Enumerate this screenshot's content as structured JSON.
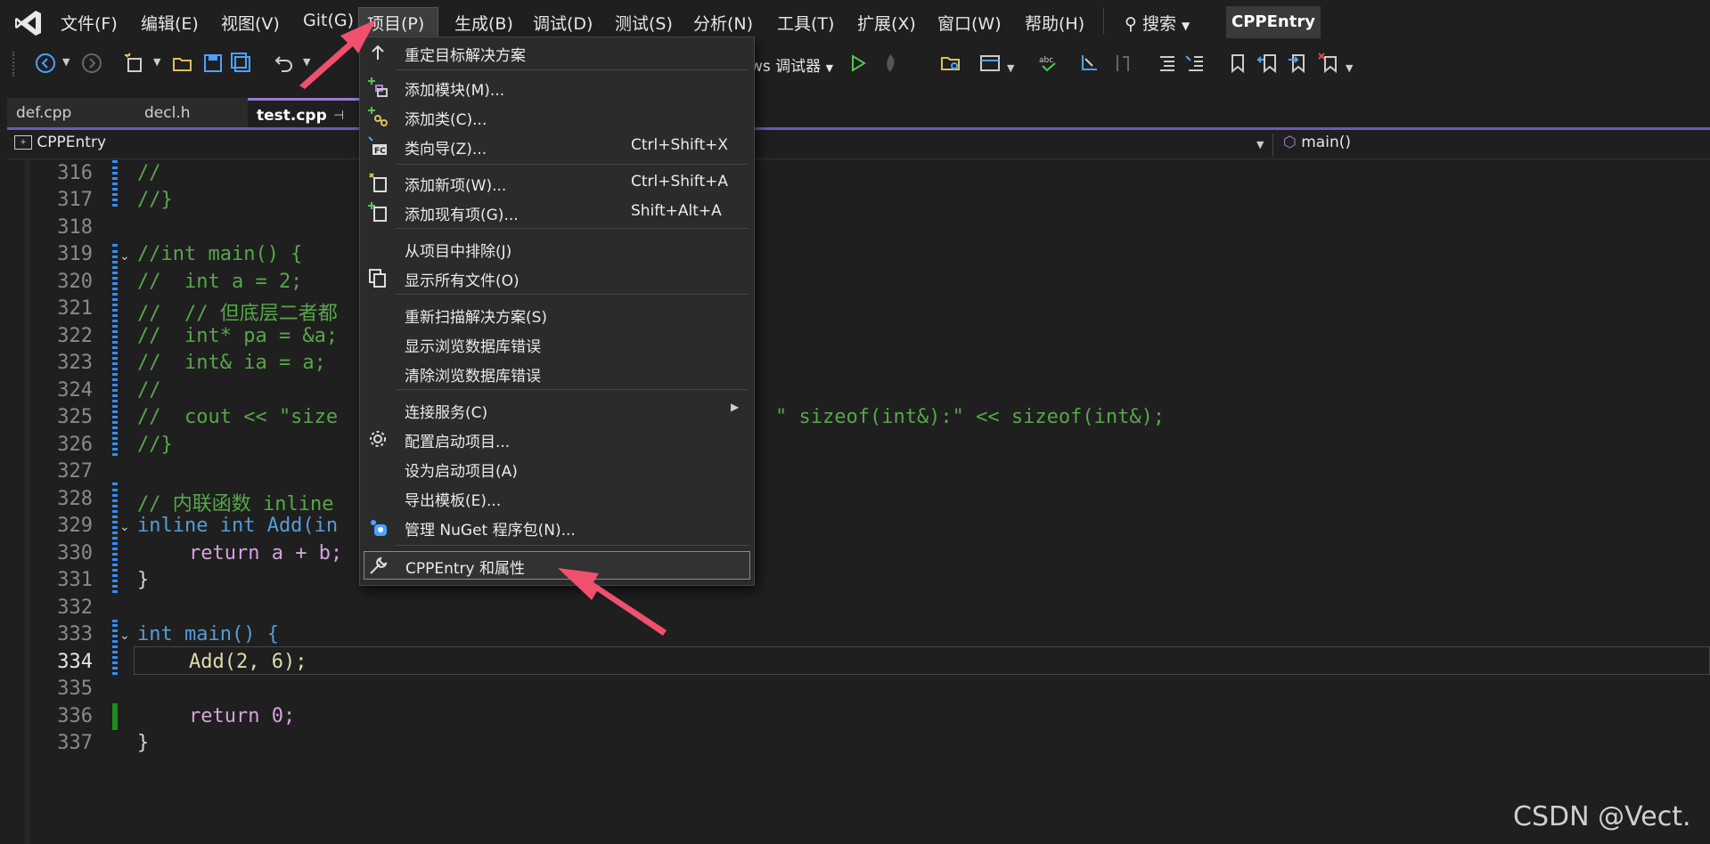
{
  "menubar": {
    "items": [
      "文件(F)",
      "编辑(E)",
      "视图(V)",
      "Git(G)",
      "项目(P)",
      "生成(B)",
      "调试(D)",
      "测试(S)",
      "分析(N)",
      "工具(T)",
      "扩展(X)",
      "窗口(W)",
      "帮助(H)"
    ],
    "search_label": "搜索",
    "solution_name": "CPPEntry"
  },
  "toolbar": {
    "debugger_label": "ws 调试器"
  },
  "tabs": [
    {
      "label": "def.cpp",
      "active": false
    },
    {
      "label": "decl.h",
      "active": false
    },
    {
      "label": "test.cpp",
      "active": true
    }
  ],
  "navbar": {
    "project": "CPPEntry",
    "member": "main()"
  },
  "editor": {
    "current_line": 334,
    "lines": [
      {
        "n": "316",
        "text": "//"
      },
      {
        "n": "317",
        "text": "//}"
      },
      {
        "n": "318",
        "text": ""
      },
      {
        "n": "319",
        "text": "//int main() {"
      },
      {
        "n": "320",
        "text": "//  int a = 2;"
      },
      {
        "n": "321",
        "text": "//  // 但底层二者都"
      },
      {
        "n": "322",
        "text": "//  int* pa = &a;"
      },
      {
        "n": "323",
        "text": "//  int& ia = a;"
      },
      {
        "n": "324",
        "text": "//"
      },
      {
        "n": "325",
        "text": "//  cout << \"size"
      },
      {
        "n": "326",
        "text": "//}"
      },
      {
        "n": "327",
        "text": ""
      },
      {
        "n": "328",
        "text": "// 内联函数 inline"
      },
      {
        "n": "329",
        "text": "inline int Add(in"
      },
      {
        "n": "330",
        "text": "return a + b;"
      },
      {
        "n": "331",
        "text": "}"
      },
      {
        "n": "332",
        "text": ""
      },
      {
        "n": "333",
        "text": "int main() {"
      },
      {
        "n": "334",
        "text": "Add(2, 6);"
      },
      {
        "n": "335",
        "text": ""
      },
      {
        "n": "336",
        "text": "return 0;"
      },
      {
        "n": "337",
        "text": "}"
      }
    ],
    "line_325_tail": "\" sizeof(int&):\" << sizeof(int&);"
  },
  "context_menu": {
    "items": [
      {
        "label": "重定目标解决方案",
        "shortcut": "",
        "icon": "arrow-up-icon"
      },
      {
        "label": "添加模块(M)...",
        "shortcut": "",
        "icon": "add-module-icon"
      },
      {
        "label": "添加类(C)...",
        "shortcut": "",
        "icon": "add-class-icon"
      },
      {
        "label": "类向导(Z)...",
        "shortcut": "Ctrl+Shift+X",
        "icon": "class-wizard-icon"
      },
      {
        "label": "添加新项(W)...",
        "shortcut": "Ctrl+Shift+A",
        "icon": "add-new-item-icon"
      },
      {
        "label": "添加现有项(G)...",
        "shortcut": "Shift+Alt+A",
        "icon": "add-existing-item-icon"
      },
      {
        "label": "从项目中排除(J)",
        "shortcut": "",
        "icon": ""
      },
      {
        "label": "显示所有文件(O)",
        "shortcut": "",
        "icon": "show-all-files-icon"
      },
      {
        "label": "重新扫描解决方案(S)",
        "shortcut": "",
        "icon": ""
      },
      {
        "label": "显示浏览数据库错误",
        "shortcut": "",
        "icon": ""
      },
      {
        "label": "清除浏览数据库错误",
        "shortcut": "",
        "icon": ""
      },
      {
        "label": "连接服务(C)",
        "shortcut": "",
        "icon": "",
        "submenu": true
      },
      {
        "label": "配置启动项目...",
        "shortcut": "",
        "icon": "gear-icon"
      },
      {
        "label": "设为启动项目(A)",
        "shortcut": "",
        "icon": ""
      },
      {
        "label": "导出模板(E)...",
        "shortcut": "",
        "icon": ""
      },
      {
        "label": "管理 NuGet 程序包(N)...",
        "shortcut": "",
        "icon": "nuget-icon"
      },
      {
        "label": "CPPEntry 和属性",
        "shortcut": "",
        "icon": "wrench-icon"
      }
    ]
  },
  "watermark": "CSDN @Vect.",
  "colors": {
    "accent_purple": "#6f57b5",
    "annotation_arrow": "#f0506e",
    "comment_green": "#57a64a",
    "keyword_blue": "#569cd6"
  }
}
